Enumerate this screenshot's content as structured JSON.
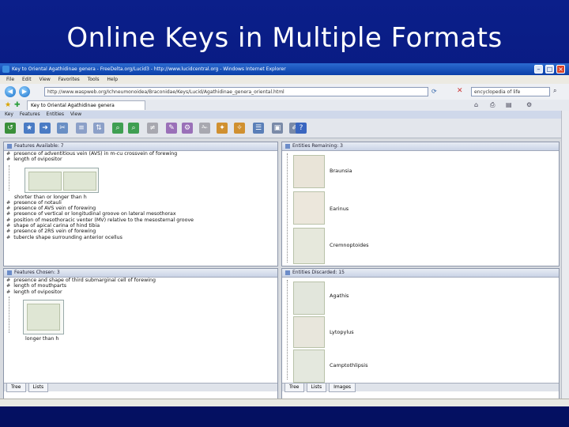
{
  "slide": {
    "title": "Online Keys in Multiple Formats"
  },
  "browser": {
    "title": "Key to Oriental Agathidinae genera - FreeDelta.org/Lucid3 - http://www.lucidcentral.org - Windows Internet Explorer",
    "menu": [
      "File",
      "Edit",
      "View",
      "Favorites",
      "Tools",
      "Help"
    ],
    "address": "http://www.waspweb.org/Ichneumonoidea/Braconidae/Keys/Lucid/Agathidinae_genera_oriental.html",
    "search_value": "encyclopedia of life",
    "tab_label": "Key to Oriental Agathidinae genera"
  },
  "app": {
    "menu": [
      "Key",
      "Features",
      "Entities",
      "View"
    ]
  },
  "panes": {
    "features_available": {
      "header": "Features Available: 7",
      "items_top": [
        "presence of adventitious vein (AVS) in m-cu crossvein of forewing",
        "length of ovipositor"
      ],
      "figure_label": "shorter than or longer than h",
      "items_bottom": [
        "presence of notauli",
        "presence of AVS vein of forewing",
        "presence of vertical or longitudinal groove on lateral mesothorax",
        "position of mesothoracic venter (MV) relative to the mesosternal groove",
        "shape of apical carina of hind tibia",
        "presence of 2RS vein of forewing",
        "tubercle shape surrounding anterior ocellus"
      ]
    },
    "features_chosen": {
      "header": "Features Chosen: 3",
      "items": [
        "presence and shape of third submarginal cell of forewing",
        "length of mouthparts",
        "length of ovipositor"
      ],
      "figure_label": "longer than h"
    },
    "entities_remaining": {
      "header": "Entities Remaining: 3",
      "entities": [
        "Braunsia",
        "Earinus",
        "Cremnoptoides"
      ]
    },
    "entities_discarded": {
      "header": "Entities Discarded: 15",
      "entities": [
        "Agathis",
        "Lytopylus",
        "Camptothlipsis"
      ]
    },
    "tabs_left": [
      "Tree",
      "Lists"
    ],
    "tabs_right": [
      "Tree",
      "Lists",
      "Images"
    ]
  }
}
